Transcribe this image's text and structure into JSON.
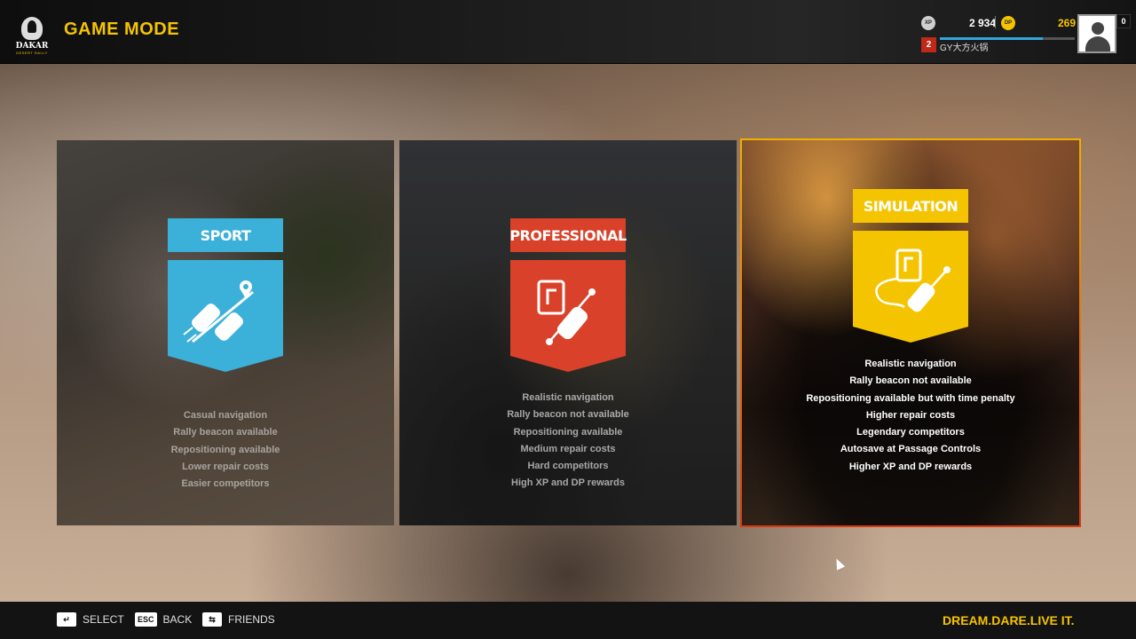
{
  "header": {
    "logo_text": "DAKAR",
    "logo_sub": "DESERT RALLY",
    "title": "GAME MODE"
  },
  "profile": {
    "xp_icon": "XP",
    "xp_value": "2 934",
    "dp_icon": "DP",
    "dp_value": "269",
    "level": "2",
    "username": "GY大方火锅",
    "xp_progress": 0.76,
    "notifications": "0",
    "avatar_icon": "user-silhouette-icon"
  },
  "modes": [
    {
      "id": "sport",
      "label": "SPORT",
      "color": "#3bb0d9",
      "icon": "two-cars-location-pin-icon",
      "features": [
        "Casual navigation",
        "Rally beacon available",
        "Repositioning available",
        "Lower repair costs",
        "Easier competitors"
      ]
    },
    {
      "id": "professional",
      "label": "PROFESSIONAL",
      "color": "#d9412a",
      "icon": "roadbook-tablet-car-icon",
      "features": [
        "Realistic navigation",
        "Rally beacon not available",
        "Repositioning available",
        "Medium repair costs",
        "Hard competitors",
        "High XP and DP rewards"
      ]
    },
    {
      "id": "simulation",
      "label": "SIMULATION",
      "color": "#f5c400",
      "selected": true,
      "icon": "roadbook-tablet-route-car-icon",
      "features": [
        "Realistic navigation",
        "Rally beacon not available",
        "Repositioning available but with time penalty",
        "Higher repair costs",
        "Legendary competitors",
        "Autosave at Passage Controls",
        "Higher XP and DP rewards"
      ]
    }
  ],
  "footer": {
    "hints": [
      {
        "key": "↵",
        "label": "SELECT"
      },
      {
        "key": "ESC",
        "label": "BACK"
      },
      {
        "key": "⇆",
        "label": "FRIENDS"
      }
    ],
    "slogan": "DREAM.DARE.LIVE IT."
  }
}
